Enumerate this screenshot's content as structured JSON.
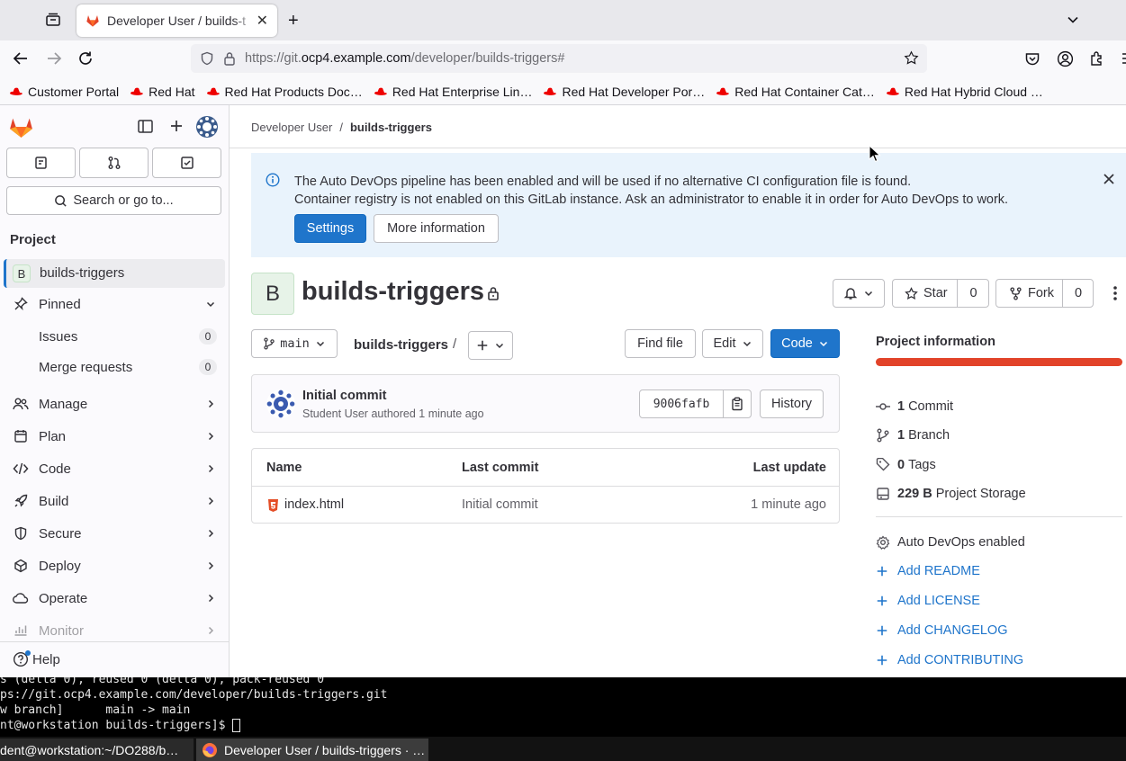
{
  "browser": {
    "tab_title": "Developer User / builds-t",
    "url_prefix": "https://git.",
    "url_host": "ocp4.example.com",
    "url_path": "/developer/builds-triggers#",
    "bookmarks": [
      "Customer Portal",
      "Red Hat",
      "Red Hat Products Doc…",
      "Red Hat Enterprise Lin…",
      "Red Hat Developer Por…",
      "Red Hat Container Cat…",
      "Red Hat Hybrid Cloud …"
    ]
  },
  "sidebar": {
    "search_label": "Search or go to...",
    "section_title": "Project",
    "project_avatar": "B",
    "project_name": "builds-triggers",
    "pinned_label": "Pinned",
    "pinned_items": [
      {
        "label": "Issues",
        "count": "0"
      },
      {
        "label": "Merge requests",
        "count": "0"
      }
    ],
    "menu": [
      "Manage",
      "Plan",
      "Code",
      "Build",
      "Secure",
      "Deploy",
      "Operate",
      "Monitor"
    ],
    "help_label": "Help"
  },
  "breadcrumb": {
    "parent": "Developer User",
    "current": "builds-triggers",
    "separator": "/"
  },
  "alert": {
    "line1": "The Auto DevOps pipeline has been enabled and will be used if no alternative CI configuration file is found.",
    "line2": "Container registry is not enabled on this GitLab instance. Ask an administrator to enable it in order for Auto DevOps to work.",
    "settings_button": "Settings",
    "more_button": "More information"
  },
  "project": {
    "avatar": "B",
    "title": "builds-triggers",
    "star_label": "Star",
    "star_count": "0",
    "fork_label": "Fork",
    "fork_count": "0"
  },
  "repo": {
    "branch": "main",
    "path": "builds-triggers",
    "path_sep": "/",
    "find_file": "Find file",
    "edit": "Edit",
    "code": "Code"
  },
  "commit": {
    "title": "Initial commit",
    "author": "Student User",
    "meta": "authored 1 minute ago",
    "sha": "9006fafb",
    "history": "History"
  },
  "files": {
    "headers": [
      "Name",
      "Last commit",
      "Last update"
    ],
    "rows": [
      {
        "name": "index.html",
        "last_commit": "Initial commit",
        "last_update": "1 minute ago"
      }
    ]
  },
  "info": {
    "title": "Project information",
    "stats": [
      {
        "value": "1",
        "label": "Commit",
        "icon": "commit-icon"
      },
      {
        "value": "1",
        "label": "Branch",
        "icon": "branch-icon"
      },
      {
        "value": "0",
        "label": "Tags",
        "icon": "tag-icon"
      },
      {
        "value": "229 B",
        "label": "Project Storage",
        "icon": "storage-icon"
      }
    ],
    "autodevops": "Auto DevOps enabled",
    "links": [
      "Add README",
      "Add LICENSE",
      "Add CHANGELOG",
      "Add CONTRIBUTING"
    ]
  },
  "terminal": {
    "lines": [
      "s (delta 0), reused 0 (delta 0), pack-reused 0",
      "ps://git.ocp4.example.com/developer/builds-triggers.git",
      "w branch]      main -> main",
      "nt@workstation builds-triggers]$ "
    ]
  },
  "taskbar": {
    "items": [
      "dent@workstation:~/DO288/b…",
      "Developer User / builds-triggers · …"
    ]
  },
  "colors": {
    "accent": "#1f75cb",
    "brand": "#e24329",
    "progress": "#e24329"
  }
}
